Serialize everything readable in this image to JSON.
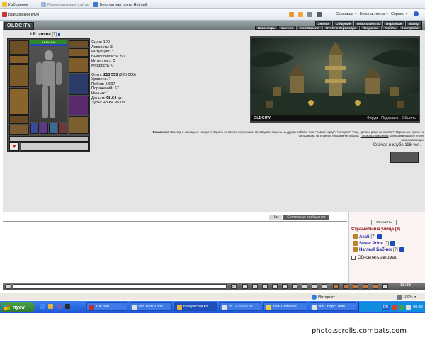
{
  "ie": {
    "favorites_label": "Избранное",
    "bookmarks": [
      "Рекомендуемые сайты",
      "Бесплатная почта Hotmail"
    ],
    "tab_title": "Бойцовский клуб",
    "menu": [
      "Страница",
      "Безопасность",
      "Сервис"
    ],
    "status_zone": "Интернет",
    "zoom": "100%"
  },
  "game": {
    "logo": "OLDCITY",
    "menu_top": [
      "Знания",
      "Общение",
      "Безопасность",
      "Персонаж",
      "Выход"
    ],
    "menu_bottom": [
      "Инвентарь",
      "Умения",
      "Мой Скролл",
      "Отчёт о переводах",
      "Поединки",
      "Анкета",
      "Настройки"
    ],
    "character": {
      "nick": "LR lamine",
      "level": "[7]",
      "info": "i",
      "hp": "1243/1243"
    },
    "stats": {
      "strength": "Сила: 100",
      "agility": "Ловкость: 3",
      "intuition": "Интуиция: 3",
      "endurance": "Выносливость: 50",
      "intellect": "Интеллект: 0",
      "wisdom": "Мудрость: 0",
      "exp_label": "Опыт:",
      "exp_value": "213 553",
      "exp_next": "(225 000)",
      "levels": "Уровень: 7",
      "wins": "Побед: 5 597",
      "losses": "Поражений: 67",
      "draws": "Ничьих: 1",
      "money_label": "Деньги:",
      "money_value": "98.64",
      "money_unit": "кр.",
      "teeth": "Зубы: +3 ₽4 ₽6.03"
    },
    "scene": {
      "logo": "OLDCITY",
      "links": [
        "Форум",
        "Подсказка",
        "Объекты"
      ]
    },
    "warning": {
      "title": "Внимание!",
      "text": "Никогда и никому не говорите пароль от своего персонажа. Не вводите пароль на других сайтах, типа \"новый город\", \"лотерея\", \"там, где все дают на халяву\". Пароль не нужен ни паладинам, ни кланам, ни администрации,",
      "link": "только взломщикам",
      "tail": "для кражи вашего героя.",
      "sign": "Администрация"
    },
    "online": "Сейчас в клубе 116 чел.",
    "chat_tabs": [
      "Чат",
      "Системные сообщения"
    ],
    "side": {
      "refresh": "Обновить",
      "location": "Страшилкина улица (3)",
      "users": [
        {
          "name": "Akali",
          "level": "[7]"
        },
        {
          "name": "Street Pride",
          "level": "[7]"
        },
        {
          "name": "Наглый Бабник",
          "level": "[7]"
        }
      ],
      "auto_refresh": "Обновлять автомат."
    },
    "clock": "11:36"
  },
  "taskbar": {
    "start": "пуск",
    "tasks": [
      "The Bat!",
      "Info.UPB: Голо...",
      "Бойцовский кл...",
      "25.12.2012 Гол...",
      "Total Command...",
      "ABC Барс: Тейв..."
    ],
    "lang": "EN",
    "time": "09:36"
  },
  "watermark": "photo.scrolls.combats.com"
}
